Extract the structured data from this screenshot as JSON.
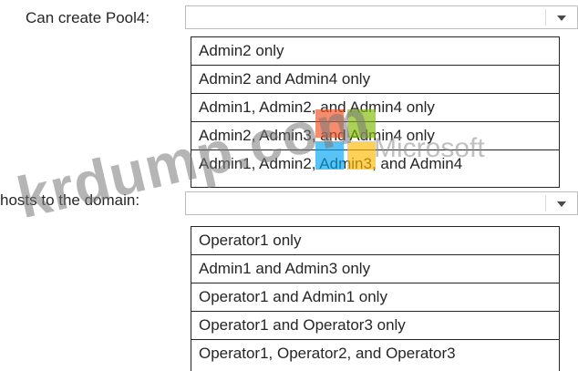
{
  "question1": {
    "label": "Can create Pool4:",
    "selected_value": "",
    "options": [
      "Admin2 only",
      "Admin2 and Admin4 only",
      "Admin1, Admin2, and Admin4 only",
      "Admin2, Admin3, and Admin4 only",
      "Admin1, Admin2, Admin3, and Admin4"
    ]
  },
  "question2": {
    "label": "hosts to the domain:",
    "selected_value": "",
    "options": [
      "Operator1 only",
      "Admin1 and Admin3 only",
      "Operator1 and Admin1 only",
      "Operator1 and Operator3 only",
      "Operator1, Operator2, and Operator3"
    ]
  },
  "watermark": {
    "site": "krdump.com",
    "brand": "Microsoft",
    "logo_colors": [
      "#f25022",
      "#7fba00",
      "#00a4ef",
      "#ffb900"
    ]
  }
}
